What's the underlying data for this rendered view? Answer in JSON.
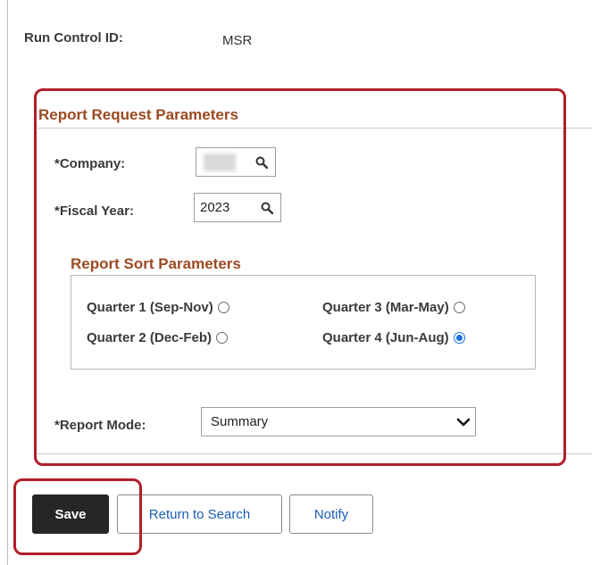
{
  "run_control": {
    "label": "Run Control ID:",
    "value": "MSR"
  },
  "report_request": {
    "title": "Report Request Parameters",
    "company": {
      "label": "*Company:",
      "value": ""
    },
    "fiscal_year": {
      "label": "*Fiscal Year:",
      "value": "2023"
    }
  },
  "report_sort": {
    "title": "Report Sort Parameters",
    "options": [
      {
        "label": "Quarter 1 (Sep-Nov)",
        "selected": false
      },
      {
        "label": "Quarter 3 (Mar-May)",
        "selected": false
      },
      {
        "label": "Quarter 2 (Dec-Feb)",
        "selected": false
      },
      {
        "label": "Quarter 4 (Jun-Aug)",
        "selected": true
      }
    ]
  },
  "report_mode": {
    "label": "*Report Mode:",
    "value": "Summary"
  },
  "buttons": {
    "save": "Save",
    "return": "Return to Search",
    "notify": "Notify"
  },
  "colors": {
    "highlight": "#b11f2a",
    "section_title": "#9c4a22",
    "link": "#1a5fb4",
    "radio_selected": "#1a73e8"
  },
  "icons": {
    "lookup": "search-icon",
    "dropdown": "chevron-down-icon"
  }
}
